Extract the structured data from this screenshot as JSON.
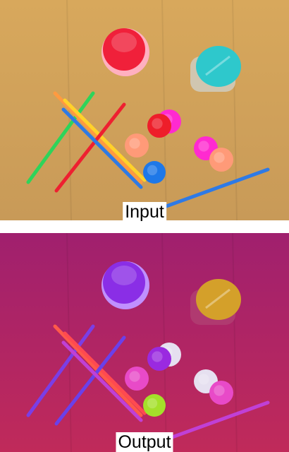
{
  "captions": {
    "input": "Input",
    "output": "Output"
  },
  "palettes": {
    "input": {
      "bg_top": "#d8a85c",
      "bg_bottom": "#c89a58",
      "cup": "#f0203a",
      "cup_rim": "#ffb0c0",
      "jar_lid": "#2ec8cc",
      "jar_body": "#d0c6b0",
      "cap_red": "#ee1e2a",
      "cap_magenta": "#ff2ad0",
      "cap_peach": "#ff9a78",
      "cap_blue": "#1e78e8",
      "straw_green": "#2ed45a",
      "straw_red": "#ee2030",
      "straw_yellow": "#ffd22a",
      "straw_blue": "#2e7ae6",
      "straw_orange": "#ff9a40"
    },
    "output": {
      "bg_top": "#a0206e",
      "bg_bottom": "#c02a5a",
      "cup": "#8a2ee6",
      "cup_rim": "#c090ff",
      "jar_lid": "#d4a02a",
      "jar_body": "#b03a70",
      "cap_red": "#9a2ae0",
      "cap_magenta": "#e6e0f0",
      "cap_peach": "#e84ac8",
      "cap_blue": "#a4e02a",
      "straw_green": "#7a3ee6",
      "straw_red": "#6a40ea",
      "straw_yellow": "#ff4a50",
      "straw_blue": "#c040d6",
      "straw_orange": "#ff5a4a"
    }
  }
}
